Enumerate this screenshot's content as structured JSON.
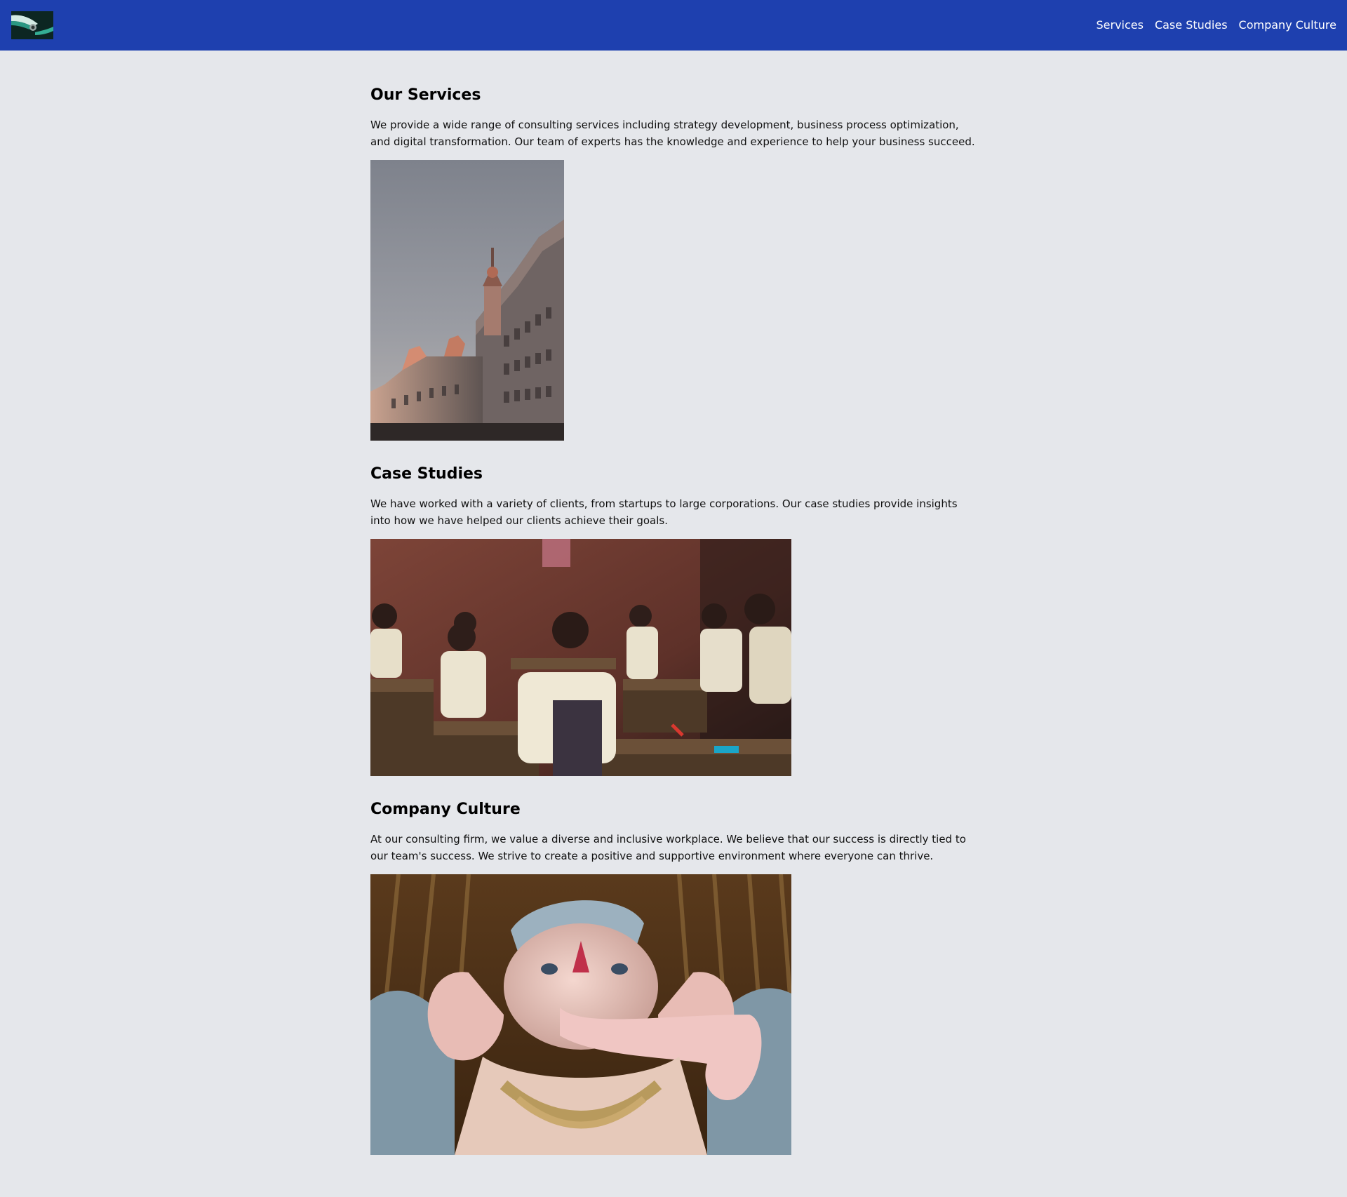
{
  "header": {
    "background_color": "#1e40af",
    "logo_icon": "logo-image",
    "nav": [
      {
        "label": "Services"
      },
      {
        "label": "Case Studies"
      },
      {
        "label": "Company Culture"
      }
    ]
  },
  "page": {
    "background_color": "#e5e7eb"
  },
  "sections": [
    {
      "title": "Our Services",
      "text": "We provide a wide range of consulting services including strategy development, business process optimization, and digital transformation. Our team of experts has the knowledge and experience to help your business succeed.",
      "image_subject": "ornate-building-street-photo"
    },
    {
      "title": "Case Studies",
      "text": "We have worked with a variety of clients, from startups to large corporations. Our case studies provide insights into how we have helped our clients achieve their goals.",
      "image_subject": "classroom-students-photo"
    },
    {
      "title": "Company Culture",
      "text": "At our consulting firm, we value a diverse and inclusive workplace. We believe that our success is directly tied to our team's success. We strive to create a positive and supportive environment where everyone can thrive.",
      "image_subject": "elephant-deity-statue-photo"
    }
  ]
}
